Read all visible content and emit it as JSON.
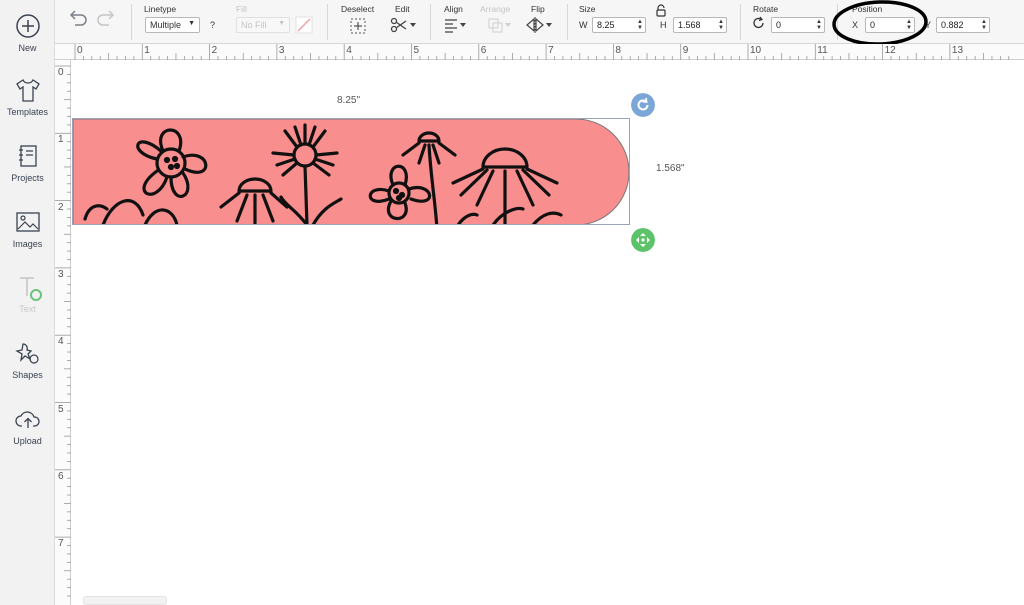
{
  "sidebar": {
    "items": [
      {
        "label": "New",
        "icon": "plus-circle-icon"
      },
      {
        "label": "Templates",
        "icon": "tshirt-icon"
      },
      {
        "label": "Projects",
        "icon": "notebook-icon"
      },
      {
        "label": "Images",
        "icon": "image-icon"
      },
      {
        "label": "Text",
        "icon": "text-icon"
      },
      {
        "label": "Shapes",
        "icon": "shapes-icon"
      },
      {
        "label": "Upload",
        "icon": "cloud-upload-icon"
      }
    ]
  },
  "toolbar": {
    "linetype_label": "Linetype",
    "linetype_value": "Multiple",
    "linetype_help": "?",
    "fill_label": "Fill",
    "fill_value": "No Fill",
    "deselect_label": "Deselect",
    "edit_label": "Edit",
    "align_label": "Align",
    "arrange_label": "Arrange",
    "flip_label": "Flip",
    "size_label": "Size",
    "size_w_label": "W",
    "size_w_value": "8.25",
    "size_h_label": "H",
    "size_h_value": "1.568",
    "rotate_label": "Rotate",
    "rotate_value": "0",
    "position_label": "Position",
    "position_x_label": "X",
    "position_x_value": "0",
    "position_y_label": "Y",
    "position_y_value": "0.882"
  },
  "rulers": {
    "top": [
      "0",
      "1",
      "2",
      "3",
      "4",
      "5",
      "6",
      "7",
      "8",
      "9",
      "10",
      "11",
      "12",
      "13"
    ],
    "left": [
      "0",
      "1",
      "2",
      "3",
      "4",
      "5",
      "6",
      "7"
    ]
  },
  "canvas": {
    "width_label": "8.25\"",
    "height_label": "1.568\""
  },
  "colors": {
    "design_fill": "#f98e8e",
    "rotate_handle": "#7ba7d8",
    "move_handle": "#5cc36a",
    "annotation_ring": "#000000"
  }
}
